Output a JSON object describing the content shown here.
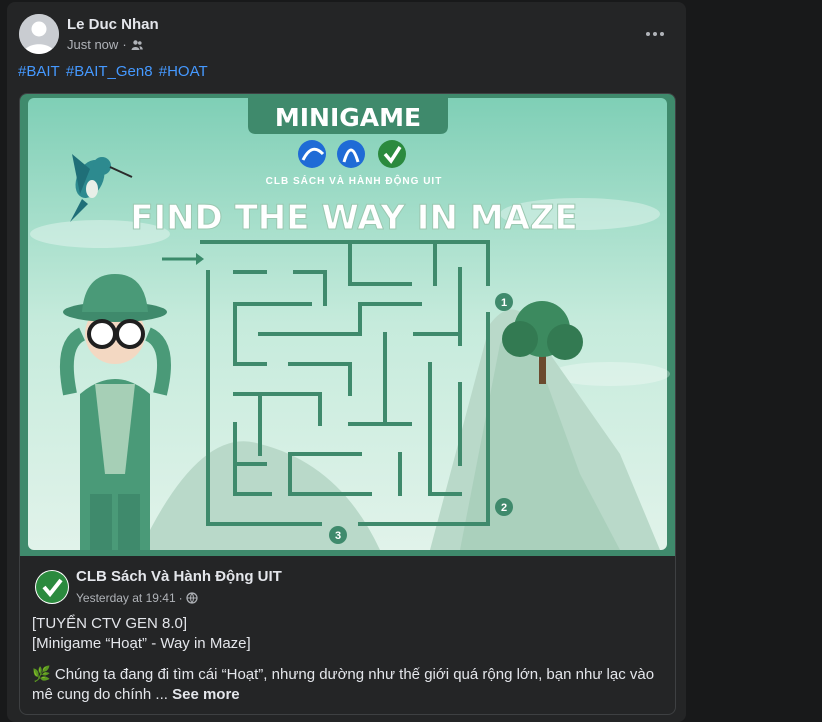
{
  "post": {
    "author": "Le Duc Nhan",
    "time": "Just now",
    "audience_icon": "friends-icon",
    "more_icon": "more-options-icon",
    "hashtags": [
      "#BAIT",
      "#BAIT_Gen8",
      "#HOAT"
    ]
  },
  "image": {
    "banner": "MINIGAME",
    "club": "CLB SÁCH VÀ HÀNH ĐỘNG UIT",
    "headline": "FIND THE WAY IN MAZE",
    "exit_labels": [
      "1",
      "2",
      "3"
    ],
    "colors": {
      "sky": "#d2efe3",
      "green": "#3f8a6c",
      "dark_green": "#2f7559"
    }
  },
  "shared": {
    "page_name": "CLB Sách Và Hành Động UIT",
    "time": "Yesterday at 19:41",
    "privacy_icon": "globe-icon",
    "line1": "[TUYỂN CTV GEN 8.0]",
    "line2": "[Minigame “Hoạt” -  Way in Maze]",
    "emoji": "🌿",
    "body": " Chúng ta đang đi tìm cái “Hoạt”, nhưng dường như thế giới quá rộng lớn, bạn như lạc vào mê cung do chính ... ",
    "see_more": "See more"
  }
}
